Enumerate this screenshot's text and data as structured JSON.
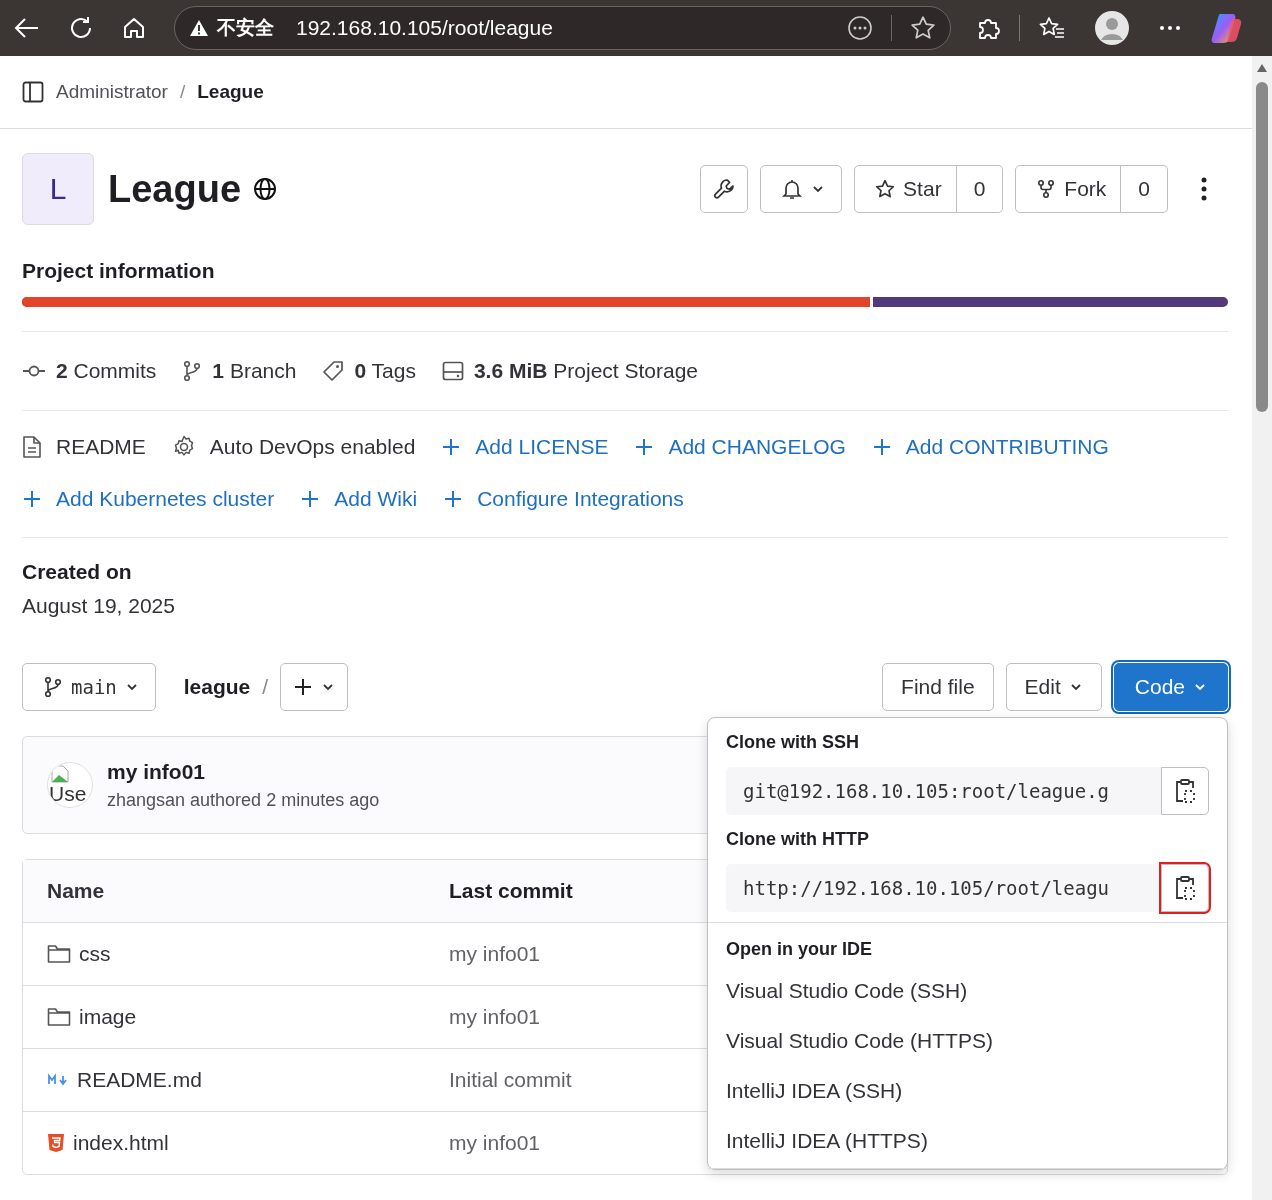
{
  "browser": {
    "security_label": "不安全",
    "url": "192.168.10.105/root/league"
  },
  "breadcrumb_separator": "/",
  "breadcrumbs": [
    {
      "label": "Administrator",
      "current": false
    },
    {
      "label": "League",
      "current": true
    }
  ],
  "project": {
    "avatar_letter": "L",
    "name": "League"
  },
  "header_actions": {
    "star_label": "Star",
    "star_count": "0",
    "fork_label": "Fork",
    "fork_count": "0"
  },
  "project_information": {
    "title": "Project information",
    "storage_bar": {
      "level": 0.706
    }
  },
  "stats": [
    {
      "kind": "commit",
      "count": "2",
      "label": "Commits"
    },
    {
      "kind": "branch",
      "count": "1",
      "label": "Branch"
    },
    {
      "kind": "tag",
      "count": "0",
      "label": "Tags"
    },
    {
      "kind": "storage",
      "count": "3.6 MiB",
      "label": "Project Storage"
    }
  ],
  "shortcut_rows": [
    [
      {
        "kind": "readme",
        "label": "README"
      },
      {
        "kind": "devops",
        "label": "Auto DevOps enabled"
      },
      {
        "kind": "add",
        "label": "Add LICENSE"
      },
      {
        "kind": "add",
        "label": "Add CHANGELOG"
      },
      {
        "kind": "add",
        "label": "Add CONTRIBUTING"
      }
    ],
    [
      {
        "kind": "add",
        "label": "Add Kubernetes cluster"
      },
      {
        "kind": "add",
        "label": "Add Wiki"
      },
      {
        "kind": "add",
        "label": "Configure Integrations"
      }
    ]
  ],
  "created": {
    "label": "Created on",
    "date": "August 19, 2025"
  },
  "repo_bar": {
    "branch": "main",
    "path": "league",
    "path_separator": "/",
    "find_file": "Find file",
    "edit": "Edit",
    "code": "Code",
    "code_open": true
  },
  "last_commit": {
    "title": "my info01",
    "author_line": "zhangsan authored 2 minutes ago",
    "avatar_alt": "Use"
  },
  "table": {
    "columns": [
      "Name",
      "Last commit"
    ],
    "rows": [
      {
        "kind": "folder",
        "name": "css",
        "last_commit": "my info01"
      },
      {
        "kind": "folder",
        "name": "image",
        "last_commit": "my info01"
      },
      {
        "kind": "markdown",
        "name": "README.md",
        "last_commit": "Initial commit"
      },
      {
        "kind": "html",
        "name": "index.html",
        "last_commit": "my info01"
      }
    ]
  },
  "code_dropdown": {
    "clone": [
      {
        "label": "Clone with SSH",
        "url": "git@192.168.10.105:root/league.g",
        "highlighted": false
      },
      {
        "label": "Clone with HTTP",
        "url": "http://192.168.10.105/root/leagu",
        "highlighted": true
      }
    ],
    "ide_title": "Open in your IDE",
    "ide_items": [
      "Visual Studio Code (SSH)",
      "Visual Studio Code (HTTPS)",
      "IntelliJ IDEA (SSH)",
      "IntelliJ IDEA (HTTPS)"
    ]
  }
}
